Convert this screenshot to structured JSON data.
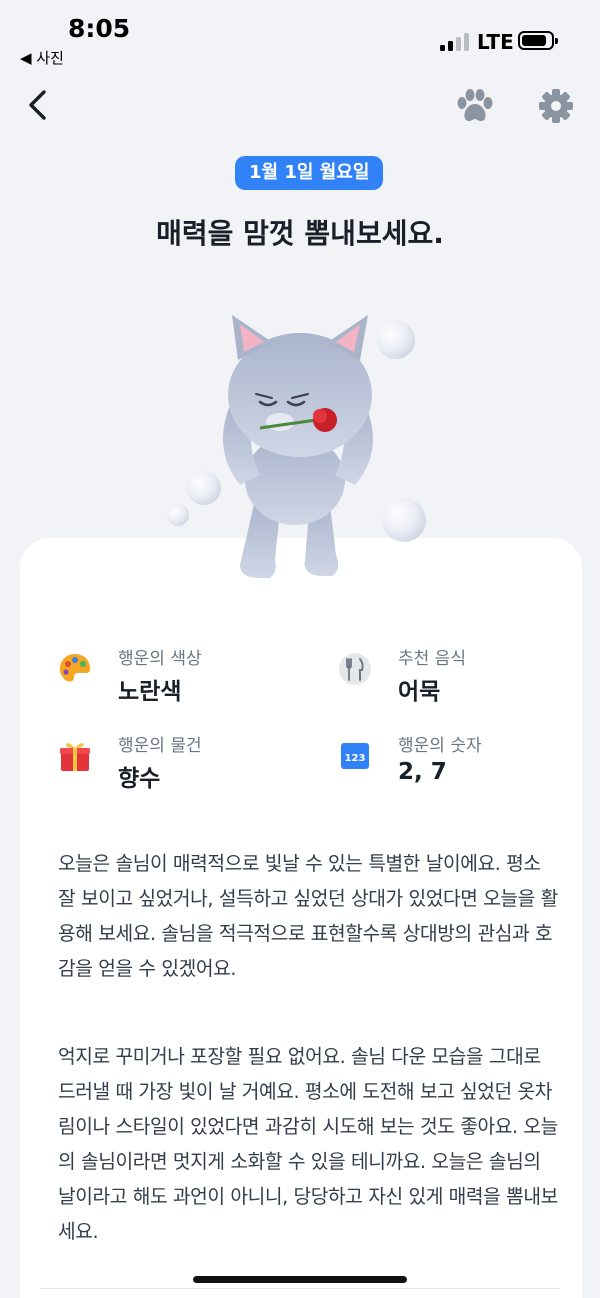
{
  "status_bar": {
    "time": "8:05",
    "back_app": "◀ 사진",
    "network": "LTE"
  },
  "nav": {
    "back": "back",
    "paw": "paw",
    "settings": "settings"
  },
  "header": {
    "date_badge": "1월 1일 월요일",
    "headline": "매력을 맘껏 뽐내보세요."
  },
  "colors": {
    "accent": "#3182f6",
    "background": "#f2f3f6",
    "card": "#ffffff"
  },
  "info": [
    {
      "icon": "palette-icon",
      "label": "행운의 색상",
      "value": "노란색"
    },
    {
      "icon": "fork-knife-icon",
      "label": "추천 음식",
      "value": "어묵"
    },
    {
      "icon": "gift-icon",
      "label": "행운의 물건",
      "value": "향수"
    },
    {
      "icon": "number-123-icon",
      "icon_text": "123",
      "label": "행운의 숫자",
      "value": "2, 7"
    }
  ],
  "paragraphs": [
    "오늘은 솔님이 매력적으로 빛날 수 있는 특별한 날이에요. 평소 잘 보이고 싶었거나, 설득하고 싶었던 상대가 있었다면 오늘을 활용해 보세요. 솔님을 적극적으로 표현할수록 상대방의 관심과 호감을 얻을 수 있겠어요.",
    "억지로 꾸미거나 포장할 필요 없어요. 솔님 다운 모습을 그대로 드러낼 때 가장 빛이 날 거예요. 평소에 도전해 보고 싶었던 옷차림이나 스타일이 있었다면 과감히 시도해 보는 것도 좋아요. 오늘의 솔님이라면 멋지게 소화할 수 있을 테니까요. 오늘은 솔님의 날이라고 해도 과언이 아니니, 당당하고 자신 있게 매력을 뽐내보세요."
  ]
}
